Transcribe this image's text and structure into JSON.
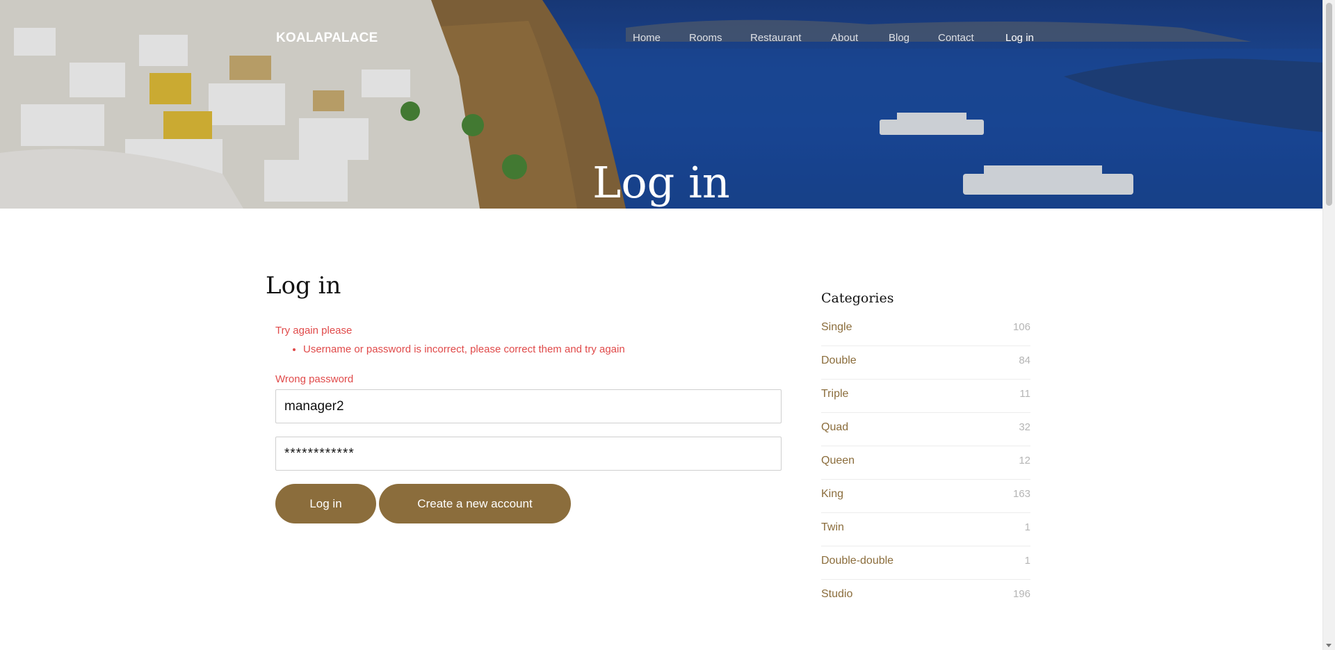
{
  "header": {
    "brand": "KOALAPALACE",
    "nav": [
      {
        "label": "Home",
        "active": false
      },
      {
        "label": "Rooms",
        "active": false
      },
      {
        "label": "Restaurant",
        "active": false
      },
      {
        "label": "About",
        "active": false
      },
      {
        "label": "Blog",
        "active": false
      },
      {
        "label": "Contact",
        "active": false
      },
      {
        "label": "Log in",
        "active": true
      }
    ],
    "hero_title": "Log in"
  },
  "main": {
    "heading": "Log in",
    "alert": {
      "title": "Try again please",
      "messages": [
        "Username or password is incorrect, please correct them and try again"
      ]
    },
    "password_error": "Wrong password",
    "username_value": "manager2",
    "password_value": "************",
    "login_button": "Log in",
    "create_button": "Create a new account"
  },
  "sidebar": {
    "heading": "Categories",
    "categories": [
      {
        "name": "Single",
        "count": "106"
      },
      {
        "name": "Double",
        "count": "84"
      },
      {
        "name": "Triple",
        "count": "11"
      },
      {
        "name": "Quad",
        "count": "32"
      },
      {
        "name": "Queen",
        "count": "12"
      },
      {
        "name": "King",
        "count": "163"
      },
      {
        "name": "Twin",
        "count": "1"
      },
      {
        "name": "Double-double",
        "count": "1"
      },
      {
        "name": "Studio",
        "count": "196"
      }
    ]
  },
  "colors": {
    "accent": "#8b6d3c",
    "error": "#e04a4a",
    "muted_count": "#b5b5b5"
  }
}
